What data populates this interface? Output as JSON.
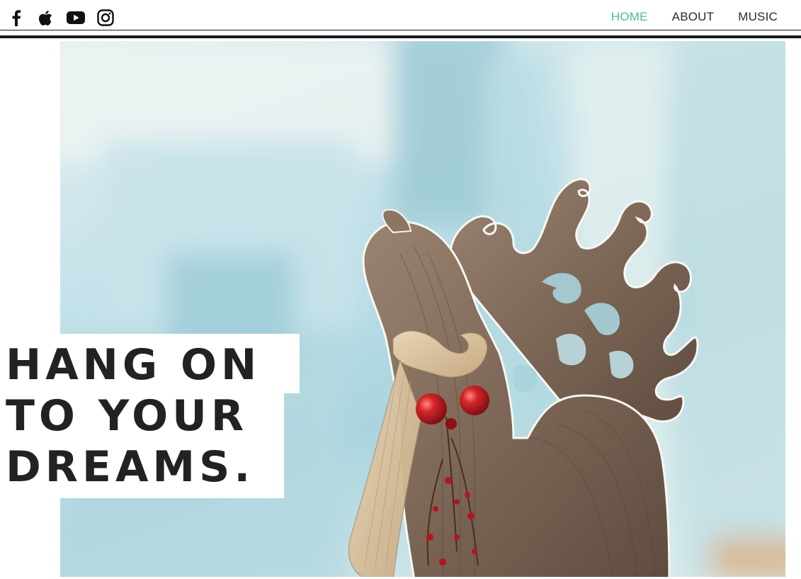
{
  "social": {
    "items": [
      {
        "icon": "facebook-icon"
      },
      {
        "icon": "apple-icon"
      },
      {
        "icon": "youtube-icon"
      },
      {
        "icon": "instagram-icon"
      }
    ]
  },
  "nav": {
    "items": [
      {
        "label": "HOME",
        "active": true
      },
      {
        "label": "ABOUT",
        "active": false
      },
      {
        "label": "MUSIC",
        "active": false
      }
    ],
    "active_color": "#48b8a4",
    "text_color": "#2a2a2a"
  },
  "hero": {
    "image": "reindeer-ornament-photo",
    "headline_lines": [
      "HANG ON",
      "TO YOUR",
      "DREAMS."
    ]
  }
}
